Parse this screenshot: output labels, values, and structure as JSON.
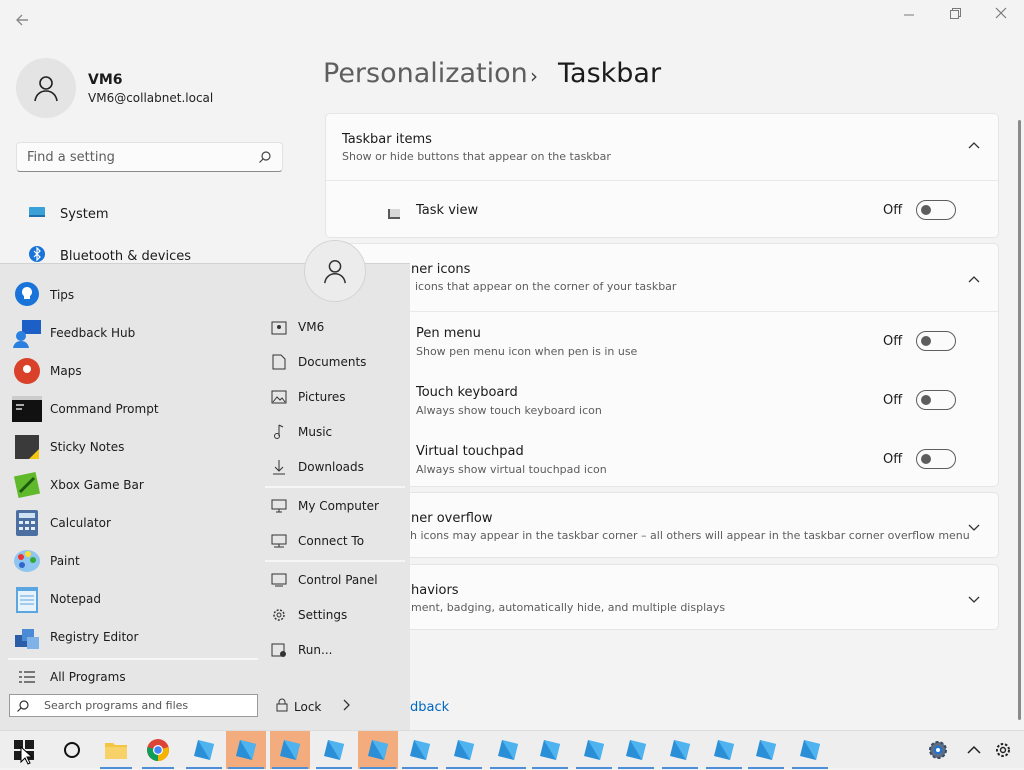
{
  "settings": {
    "user": {
      "name": "VM6",
      "email": "VM6@collabnet.local"
    },
    "search_placeholder": "Find a setting",
    "nav": [
      {
        "label": "System",
        "icon": "monitor-icon"
      },
      {
        "label": "Bluetooth & devices",
        "icon": "bluetooth-icon"
      }
    ],
    "breadcrumb": {
      "parent": "Personalization",
      "separator": "›",
      "current": "Taskbar"
    },
    "sections": {
      "taskbar_items": {
        "title": "Taskbar items",
        "subtitle": "Show or hide buttons that appear on the taskbar",
        "rows": [
          {
            "label": "Task view",
            "state": "Off"
          }
        ]
      },
      "corner_icons": {
        "title": "ner icons",
        "subtitle": "icons that appear on the corner of your taskbar",
        "rows": [
          {
            "label": "Pen menu",
            "desc": "Show pen menu icon when pen is in use",
            "state": "Off"
          },
          {
            "label": "Touch keyboard",
            "desc": "Always show touch keyboard icon",
            "state": "Off"
          },
          {
            "label": "Virtual touchpad",
            "desc": "Always show virtual touchpad icon",
            "state": "Off"
          }
        ]
      },
      "corner_overflow": {
        "title": "ner overflow",
        "subtitle": "h icons may appear in the taskbar corner – all others will appear in the taskbar corner overflow menu"
      },
      "behaviors": {
        "title": "haviors",
        "subtitle": "ment, badging, automatically hide, and multiple displays"
      }
    },
    "feedback_link": "dback"
  },
  "start_menu": {
    "left_items": [
      "Tips",
      "Feedback Hub",
      "Maps",
      "Command Prompt",
      "Sticky Notes",
      "Xbox Game Bar",
      "Calculator",
      "Paint",
      "Notepad",
      "Registry Editor"
    ],
    "all_programs": "All Programs",
    "search_placeholder": "Search programs and files",
    "right_items": [
      "VM6",
      "Documents",
      "Pictures",
      "Music",
      "Downloads",
      "My Computer",
      "Connect To",
      "Control Panel",
      "Settings",
      "Run..."
    ],
    "lock_label": "Lock"
  },
  "taskbar": {
    "icons": [
      "start-icon",
      "cortana-icon",
      "file-explorer-icon",
      "chrome-icon",
      "app-icon",
      "app-icon",
      "app-icon",
      "app-icon",
      "app-icon",
      "app-icon",
      "app-icon",
      "app-icon",
      "app-icon",
      "app-icon",
      "app-icon",
      "app-icon",
      "app-icon",
      "app-icon",
      "app-icon",
      "settings-icon",
      "tray-chevron-icon",
      "gear-icon"
    ]
  },
  "colors": {
    "accent": "#0067c0",
    "toggle_off": "#5d5d5d",
    "taskbar_active": "#f3ac7e"
  }
}
